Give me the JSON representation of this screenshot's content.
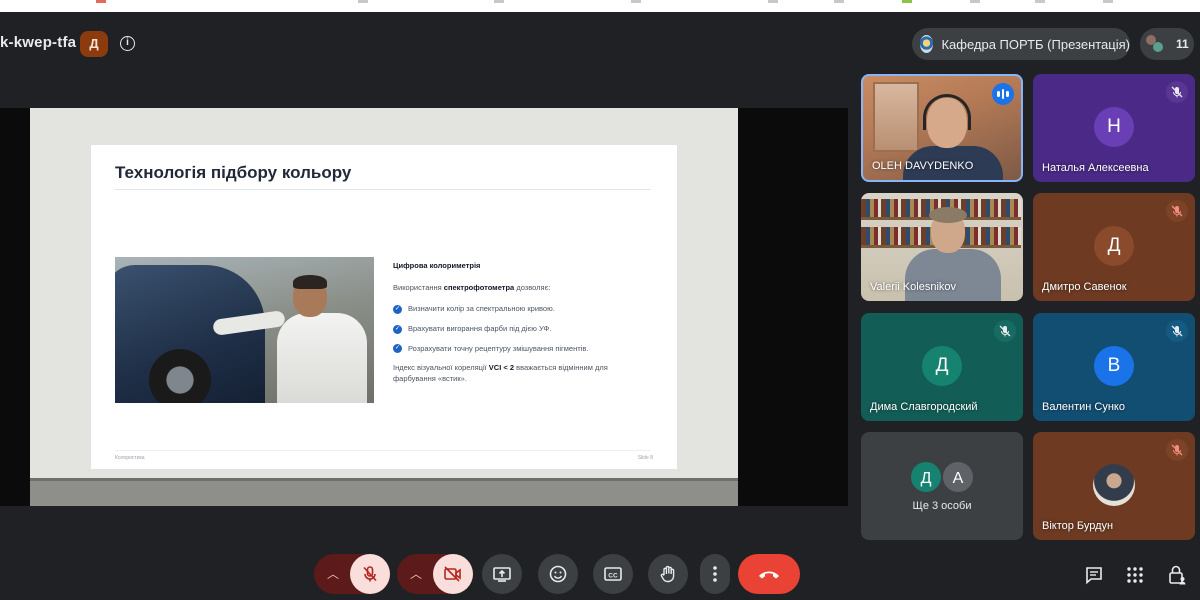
{
  "meeting": {
    "code": "k-kwep-tfa",
    "host_chip": "Д",
    "info_icon": "i",
    "presenter_label": "Кафедра ПОРТБ (Презентація)",
    "participant_count": "11"
  },
  "slide": {
    "title": "Технологія підбору кольору",
    "section_heading": "Цифрова колориметрія",
    "intro_prefix": "Використання ",
    "intro_bold": "спектрофотометра",
    "intro_suffix": " дозволяє:",
    "bullets": [
      "Визначити колір за спектральною кривою.",
      "Врахувати вигорання фарби під дією УФ.",
      "Розрахувати точну рецептуру змішування пігментів."
    ],
    "note_prefix": "Індекс візуальної кореляції ",
    "note_bold": "VCI < 2",
    "note_suffix": " вважається відмінним для фарбування «встик».",
    "footer_left": "Колористика",
    "footer_right": "Slide 8"
  },
  "participants": [
    {
      "name": "OLEH DAVYDENKO",
      "type": "video",
      "status": "speaking"
    },
    {
      "name": "Наталья Алексеевна",
      "initial": "Н",
      "type": "avatar",
      "tile_color": "#4a2a86",
      "avatar_color": "#6a3fb5",
      "status": "muted"
    },
    {
      "name": "Valerii Kolesnikov",
      "type": "video",
      "status": "unmuted"
    },
    {
      "name": "Дмитро Савенок",
      "initial": "Д",
      "type": "avatar",
      "tile_color": "#6e3a22",
      "avatar_color": "#8a4a2c",
      "status": "muted"
    },
    {
      "name": "Дима Славгородский",
      "initial": "Д",
      "type": "avatar",
      "tile_color": "#125e57",
      "avatar_color": "#15836f",
      "status": "muted"
    },
    {
      "name": "Валентин Сунко",
      "initial": "В",
      "type": "avatar",
      "tile_color": "#124e72",
      "avatar_color": "#1a73e8",
      "status": "muted"
    },
    {
      "name": "Віктор Бурдун",
      "type": "photo",
      "tile_color": "#6e3a22",
      "status": "muted"
    }
  ],
  "more_tile": {
    "initials": [
      "Д",
      "А"
    ],
    "initial_colors": [
      "#15836f",
      "#5f6368"
    ],
    "label": "Ще 3 особи"
  },
  "controls": {
    "mic": "mic-off",
    "camera": "camera-off",
    "buttons": [
      "present-screen",
      "reactions",
      "captions",
      "raise-hand",
      "more-options",
      "leave-call"
    ],
    "right": [
      "chat",
      "activities",
      "host-controls"
    ]
  },
  "colors": {
    "background": "#202124",
    "accent_speaking": "#1a73e8",
    "hangup": "#ea4335",
    "control_off": "#f9dedc"
  }
}
